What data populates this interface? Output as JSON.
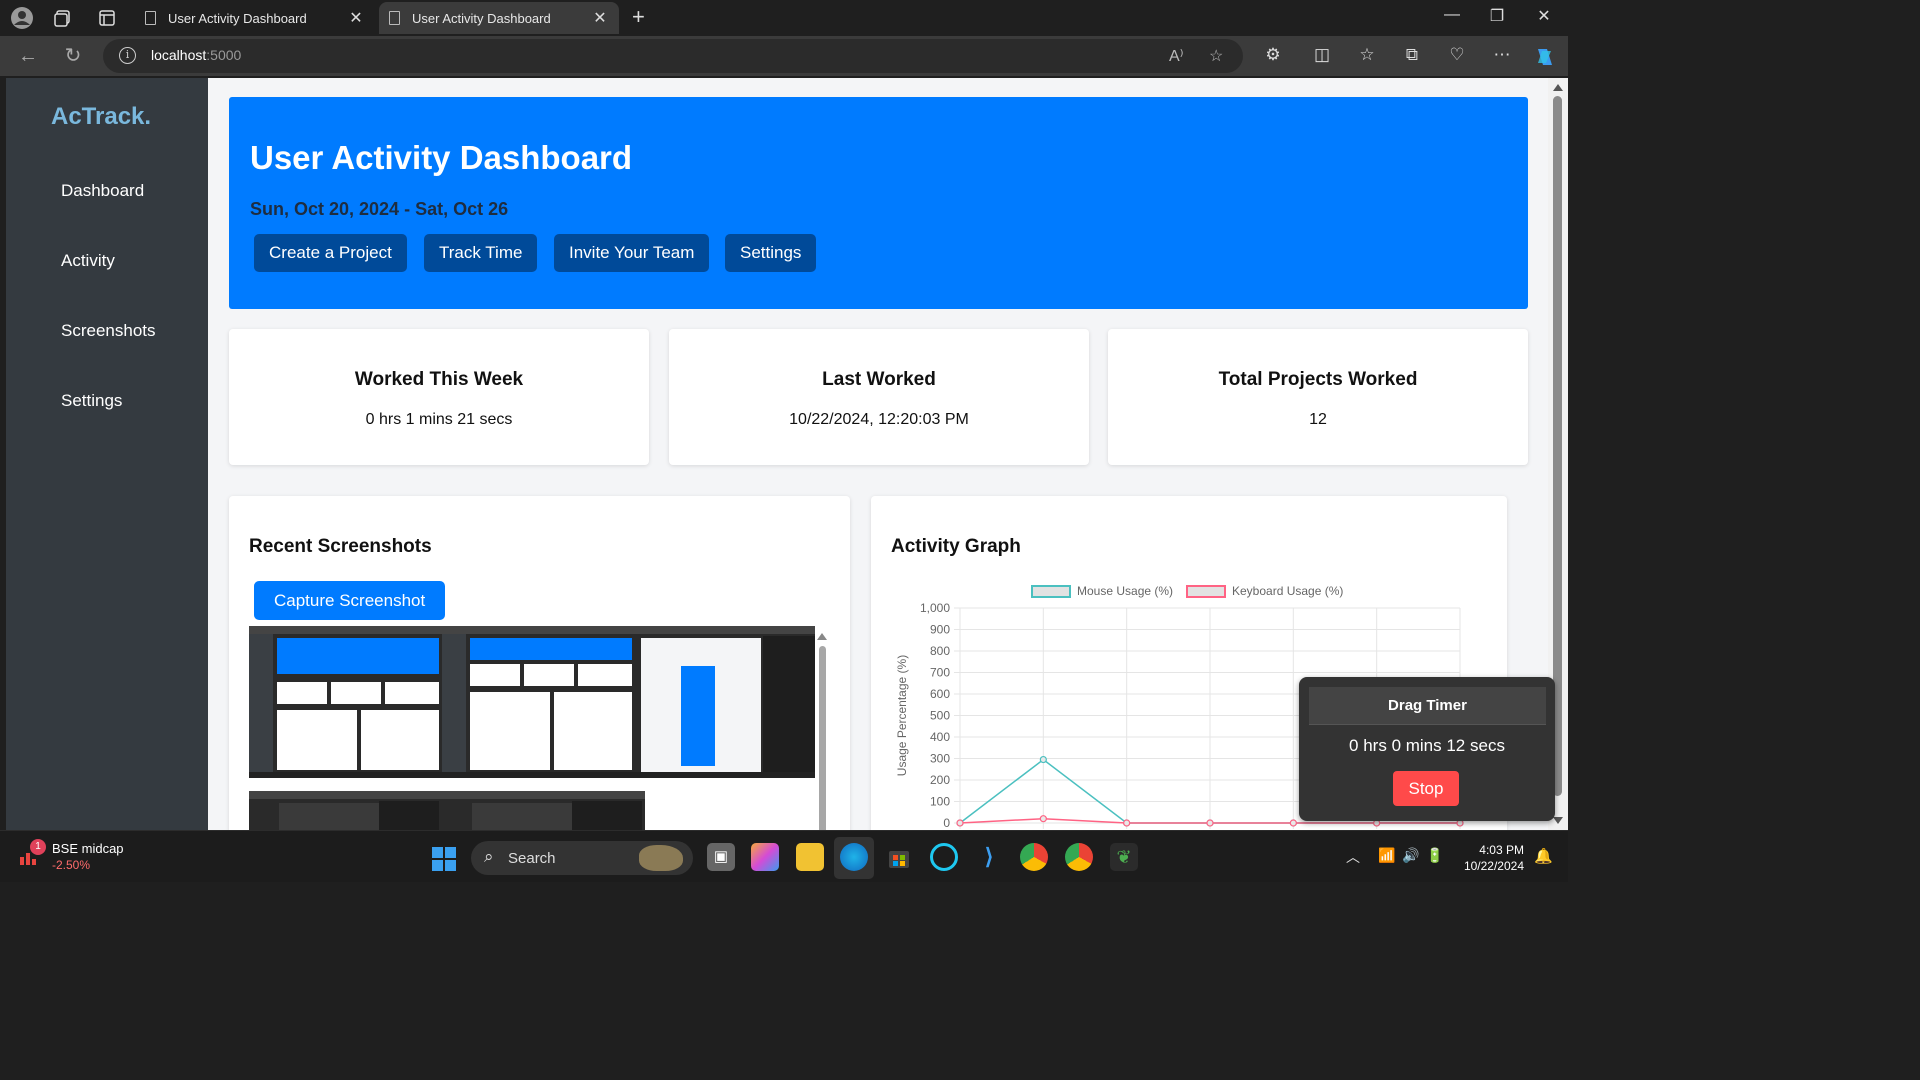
{
  "browser": {
    "tabs": [
      {
        "title": "User Activity Dashboard",
        "active": false
      },
      {
        "title": "User Activity Dashboard",
        "active": true
      }
    ],
    "url_host": "localhost",
    "url_port": ":5000"
  },
  "sidebar": {
    "logo": "AcTrack.",
    "items": [
      {
        "label": "Dashboard"
      },
      {
        "label": "Activity"
      },
      {
        "label": "Screenshots"
      },
      {
        "label": "Settings"
      }
    ]
  },
  "hero": {
    "title": "User Activity Dashboard",
    "date_range": "Sun, Oct 20, 2024 - Sat, Oct 26",
    "buttons": [
      {
        "label": "Create a Project"
      },
      {
        "label": "Track Time"
      },
      {
        "label": "Invite Your Team"
      },
      {
        "label": "Settings"
      }
    ]
  },
  "stats": [
    {
      "title": "Worked This Week",
      "value": "0 hrs 1 mins 21 secs"
    },
    {
      "title": "Last Worked",
      "value": "10/22/2024, 12:20:03 PM"
    },
    {
      "title": "Total Projects Worked",
      "value": "12"
    }
  ],
  "screenshots": {
    "title": "Recent Screenshots",
    "capture_label": "Capture Screenshot"
  },
  "graph": {
    "title": "Activity Graph"
  },
  "chart_data": {
    "type": "line",
    "title": "",
    "xlabel": "",
    "ylabel": "Usage Percentage (%)",
    "ylim": [
      0,
      1000
    ],
    "yticks": [
      "0",
      "100",
      "200",
      "300",
      "400",
      "500",
      "600",
      "700",
      "800",
      "900",
      "1,000"
    ],
    "x_count": 7,
    "grid": true,
    "legend_position": "top",
    "series": [
      {
        "name": "Mouse Usage (%)",
        "color": "#4bc0c0",
        "values": [
          0,
          295,
          0,
          0,
          0,
          0,
          0
        ]
      },
      {
        "name": "Keyboard Usage (%)",
        "color": "#ff6384",
        "values": [
          0,
          20,
          0,
          0,
          0,
          0,
          0
        ]
      }
    ]
  },
  "timer": {
    "title": "Drag Timer",
    "time": "0 hrs 0 mins 12 secs",
    "stop_label": "Stop"
  },
  "taskbar": {
    "stock_name": "BSE midcap",
    "stock_change": "-2.50%",
    "stock_badge": "1",
    "search_label": "Search",
    "time": "4:03 PM",
    "date": "10/22/2024"
  },
  "colors": {
    "primary": "#007bff",
    "primary_dark": "#004a99",
    "sidebar": "#343a40",
    "stop": "#ff4a4a"
  }
}
